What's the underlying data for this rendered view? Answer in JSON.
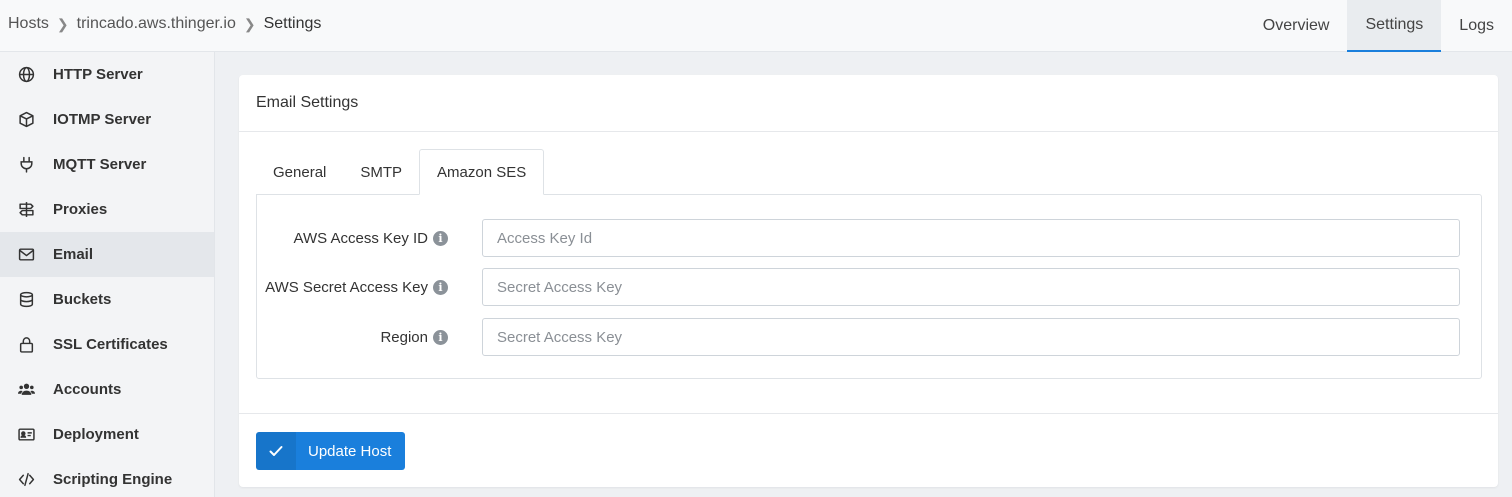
{
  "breadcrumb": [
    "Hosts",
    "trincado.aws.thinger.io",
    "Settings"
  ],
  "top_tabs": [
    {
      "label": "Overview",
      "active": false
    },
    {
      "label": "Settings",
      "active": true
    },
    {
      "label": "Logs",
      "active": false
    }
  ],
  "sidebar": {
    "items": [
      {
        "label": "HTTP Server",
        "icon": "globe-icon"
      },
      {
        "label": "IOTMP Server",
        "icon": "cube-icon"
      },
      {
        "label": "MQTT Server",
        "icon": "plug-icon"
      },
      {
        "label": "Proxies",
        "icon": "signpost-icon"
      },
      {
        "label": "Email",
        "icon": "envelope-icon",
        "active": true
      },
      {
        "label": "Buckets",
        "icon": "database-icon"
      },
      {
        "label": "SSL Certificates",
        "icon": "lock-icon"
      },
      {
        "label": "Accounts",
        "icon": "users-icon"
      },
      {
        "label": "Deployment",
        "icon": "id-card-icon"
      },
      {
        "label": "Scripting Engine",
        "icon": "code-icon"
      }
    ]
  },
  "card": {
    "title": "Email Settings",
    "tabs": [
      {
        "label": "General",
        "active": false
      },
      {
        "label": "SMTP",
        "active": false
      },
      {
        "label": "Amazon SES",
        "active": true
      }
    ],
    "fields": [
      {
        "label": "AWS Access Key ID",
        "placeholder": "Access Key Id",
        "value": ""
      },
      {
        "label": "AWS Secret Access Key",
        "placeholder": "Secret Access Key",
        "value": ""
      },
      {
        "label": "Region",
        "placeholder": "Secret Access Key",
        "value": ""
      }
    ],
    "update_button": "Update Host"
  },
  "colors": {
    "accent": "#1a7fdc"
  }
}
